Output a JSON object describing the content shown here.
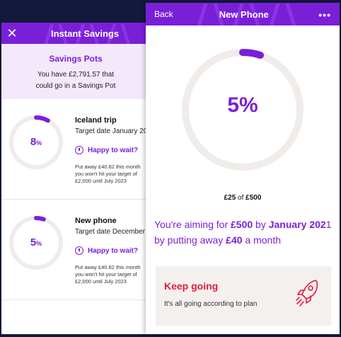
{
  "background_panel": {
    "title": "Instant Savings",
    "close_icon": "close-icon",
    "savings_pots": {
      "title": "Savings Pots",
      "description": "You have £2,791.57 that could go in a Savings Pot"
    },
    "pots": [
      {
        "name": "Iceland trip",
        "percent": "8",
        "percent_sign": "%",
        "progress": 0.08,
        "target_date": "Target date January 20",
        "wait_label": "Happy to wait?",
        "note_lines": [
          "Put away £40.82 this month",
          "you won't hit your target of",
          "£2,000 until July 2023"
        ]
      },
      {
        "name": "New phone",
        "percent": "5",
        "percent_sign": "%",
        "progress": 0.05,
        "target_date": "Target date December",
        "wait_label": "Happy to wait?",
        "note_lines": [
          "Put away £40.82 this month",
          "you won't hit your target of",
          "£2,000 until July 2023"
        ]
      }
    ]
  },
  "detail_panel": {
    "back_label": "Back",
    "title": "New Phone",
    "more_icon": "more-icon",
    "progress": 0.05,
    "percent_label": "5%",
    "progress_saved": "£25",
    "progress_of": "of",
    "progress_target": "£500",
    "aim": {
      "part1": "You're aiming for ",
      "amount": "£500",
      "part2": " by ",
      "date_bold": "January 202",
      "date_rest": "1",
      "part3": " by putting away ",
      "monthly": "£40",
      "part4": " a month"
    },
    "status": {
      "title": "Keep going",
      "description": "It's all going according to plan",
      "icon": "rocket-icon"
    }
  },
  "colors": {
    "brand_purple": "#7a1fd8",
    "ring_track": "#f0ece9",
    "status_red": "#e11d3c",
    "page_background": "#13193a"
  }
}
